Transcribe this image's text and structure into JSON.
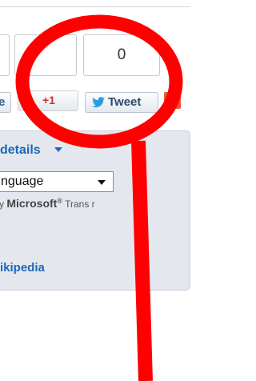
{
  "share_bar": {
    "count_boxes": [
      {
        "id": "facebook",
        "value": ""
      },
      {
        "id": "gplus",
        "value": ""
      },
      {
        "id": "twitter",
        "value": "0"
      }
    ],
    "facebook_label_fragment": "e",
    "gplus_label": "+1",
    "tweet_label": "Tweet",
    "addthis_icon": "plus-icon"
  },
  "panel": {
    "details_link": "details",
    "language_select_value": "nguage",
    "powered_prefix": "y ",
    "powered_brand": "Microsoft",
    "powered_mark": "®",
    "powered_suffix": " Trans   r",
    "wikipedia_link": "ikipedia"
  },
  "annotation": {
    "shape": "red circle with pointer line",
    "color": "#ff0000"
  }
}
